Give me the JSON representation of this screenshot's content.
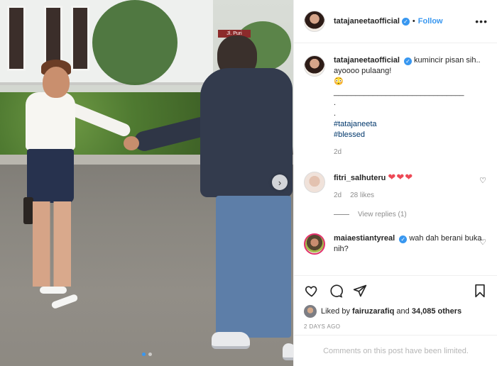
{
  "post": {
    "username": "tatajaneetaofficial",
    "follow_label": "Follow",
    "bullet": "•",
    "more_label": "•••"
  },
  "photo": {
    "sign_text": "Jl. Puri Outwood",
    "carousel_count": 2,
    "active_index": 0
  },
  "caption": {
    "username": "tatajaneetaofficial",
    "text": "kumincir pisan sih.. ayoooo pulaang!",
    "emoji": "😳",
    "divider": "______________________________",
    "dot1": ".",
    "dot2": ".",
    "hashtags": [
      "#tatajaneeta",
      "#blessed"
    ],
    "time": "2d"
  },
  "comments": [
    {
      "username": "fitri_salhuteru",
      "text": "❤❤❤",
      "time": "2d",
      "likes": "28 likes",
      "view_replies": "View replies (1)"
    },
    {
      "username": "maiaestiantyreal",
      "text": "wah dah berani buka nih?"
    }
  ],
  "actions": {
    "liked_by_prefix": "Liked by",
    "liked_by_user": "fairuzarafiq",
    "liked_by_and": "and",
    "liked_by_others": "34,085 others",
    "timestamp": "2 DAYS AGO"
  },
  "footer": {
    "limited_text": "Comments on this post have been limited."
  },
  "colors": {
    "accent": "#3897f0",
    "heart": "#ed4956",
    "muted": "#8e8e8e"
  }
}
